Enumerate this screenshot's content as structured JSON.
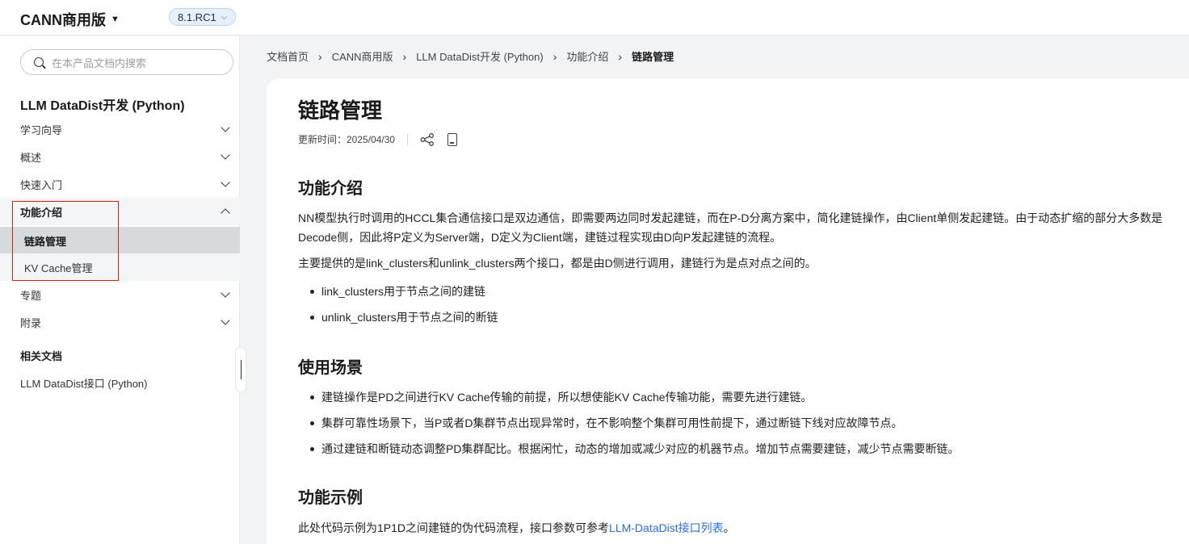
{
  "header": {
    "product": "CANN商用版",
    "version": "8.1.RC1"
  },
  "sidebar": {
    "search_placeholder": "在本产品文档内搜索",
    "doc_title": "LLM DataDist开发 (Python)",
    "items": [
      {
        "label": "学习向导"
      },
      {
        "label": "概述"
      },
      {
        "label": "快速入门"
      },
      {
        "label": "功能介绍"
      },
      {
        "label": "专题"
      },
      {
        "label": "附录"
      }
    ],
    "sub_items": [
      {
        "label": "链路管理"
      },
      {
        "label": "KV Cache管理"
      }
    ],
    "related_title": "相关文档",
    "related_link": "LLM DataDist接口 (Python)"
  },
  "breadcrumb": [
    "文档首页",
    "CANN商用版",
    "LLM DataDist开发 (Python)",
    "功能介绍",
    "链路管理"
  ],
  "article": {
    "title": "链路管理",
    "updated": "更新时间：2025/04/30",
    "sections": {
      "intro": {
        "heading": "功能介绍",
        "p1": "NN模型执行时调用的HCCL集合通信接口是双边通信，即需要两边同时发起建链，而在P-D分离方案中，简化建链操作，由Client单侧发起建链。由于动态扩缩的部分大多数是Decode侧，因此将P定义为Server端，D定义为Client端，建链过程实现由D向P发起建链的流程。",
        "p2": "主要提供的是link_clusters和unlink_clusters两个接口，都是由D侧进行调用，建链行为是点对点之间的。",
        "bullets": [
          "link_clusters用于节点之间的建链",
          "unlink_clusters用于节点之间的断链"
        ]
      },
      "scenario": {
        "heading": "使用场景",
        "bullets": [
          "建链操作是PD之间进行KV Cache传输的前提，所以想使能KV Cache传输功能，需要先进行建链。",
          "集群可靠性场景下，当P或者D集群节点出现异常时，在不影响整个集群可用性前提下，通过断链下线对应故障节点。",
          "通过建链和断链动态调整PD集群配比。根据闲忙，动态的增加或减少对应的机器节点。增加节点需要建链，减少节点需要断链。"
        ]
      },
      "example": {
        "heading": "功能示例",
        "text": "此处代码示例为1P1D之间建链的伪代码流程，接口参数可参考",
        "link": "LLM-DataDist接口列表",
        "suffix": "。"
      }
    }
  },
  "colors": {
    "link": "#2b6cf0",
    "highlight": "#d81e06",
    "active_bg": "#d7dadd"
  }
}
